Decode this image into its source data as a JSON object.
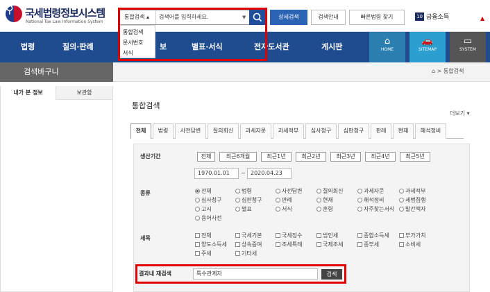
{
  "header": {
    "logo_title": "국세법령정보시스템",
    "logo_sub": "National Tax Law Information System",
    "search_scope": "통합검색 ▴",
    "search_placeholder": "검색어를 입력하세요.",
    "advanced_search": "상세검색",
    "search_guide": "검색안내",
    "quick_law": "빠른법령 찾기",
    "fin_badge": "10",
    "fin_label": "금융소득"
  },
  "dropdown": [
    "통합검색",
    "문서번호",
    "서식"
  ],
  "nav": {
    "items": [
      "법령",
      "질의·판례",
      "보",
      "별표·서식",
      "전자도서관",
      "게시판"
    ],
    "icons": [
      {
        "icon": "home-icon",
        "label": "HOME"
      },
      {
        "icon": "car-icon",
        "label": "SITEMAP"
      },
      {
        "icon": "monitor-icon",
        "label": "SYSTEM"
      }
    ]
  },
  "sidebar": {
    "basket_title": "검색바구니",
    "tab_info": "내가 본 정보",
    "tab_store": "보관함"
  },
  "breadcrumb": "⌂ > 통합검색",
  "main": {
    "title": "통합검색",
    "more": "더보기 ▾",
    "tabs": [
      "전체",
      "법령",
      "사전답변",
      "질의회신",
      "과세자문",
      "과세적부",
      "심사청구",
      "심판청구",
      "판례",
      "현재",
      "해석정비"
    ],
    "period_label": "생산기간",
    "period_buttons": [
      "전체",
      "최근6개월",
      "최근1년",
      "최근2년",
      "최근3년",
      "최근4년",
      "최근5년"
    ],
    "date_from": "1970.01.01",
    "date_sep": "~",
    "date_to": "2020.04.23",
    "type_label": "종류",
    "type_options": [
      [
        "전체",
        "법령",
        "사전답변",
        "질의회신",
        "과세자문",
        "과세적부"
      ],
      [
        "심사청구",
        "심판청구",
        "판례",
        "현재",
        "해석정비",
        "세법집행"
      ],
      [
        "고시",
        "별표",
        "서식",
        "훈령",
        "자주찾는서식",
        "발간책자"
      ],
      [
        "용어사전"
      ]
    ],
    "tax_label": "세목",
    "tax_options": [
      [
        "전체",
        "국세기본",
        "국세징수",
        "법인세",
        "종합소득세",
        "부가가치"
      ],
      [
        "양도소득세",
        "상속증여",
        "조세특례",
        "국제조세",
        "종부세",
        "소비세"
      ],
      [
        "주세",
        "기타세"
      ]
    ],
    "research_label": "결과내 재검색",
    "research_value": "특수관계자",
    "research_button": "검색"
  }
}
